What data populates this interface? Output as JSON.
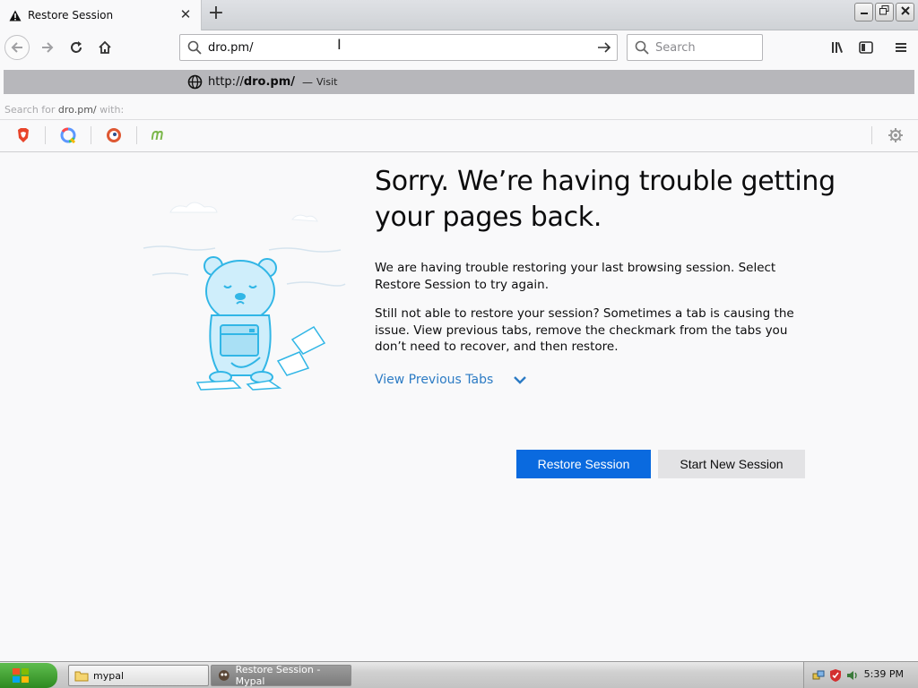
{
  "browser": {
    "tab_title": "Restore Session",
    "new_tab_label": "+",
    "window_controls": [
      "minimize",
      "restore",
      "close"
    ]
  },
  "navbar": {
    "url_value": "dro.pm/",
    "search_placeholder": "Search"
  },
  "dropdown": {
    "suggestion_scheme": "http://",
    "suggestion_host": "dro.pm/",
    "suggestion_dash": "—",
    "suggestion_action": "Visit",
    "search_for_prefix": "Search for",
    "search_for_term": "dro.pm/",
    "search_for_suffix": "with:",
    "engines": [
      "brave-icon",
      "qwant-icon",
      "duckduckgo-icon",
      "mojeek-icon"
    ]
  },
  "page": {
    "title": "Sorry. We’re having trouble getting your pages back.",
    "para1": "We are having trouble restoring your last browsing session. Select Restore Session to try again.",
    "para2": "Still not able to restore your session? Sometimes a tab is causing the issue. View previous tabs, remove the checkmark from the tabs you don’t need to recover, and then restore.",
    "view_previous_label": "View Previous Tabs",
    "restore_button_label": "Restore Session",
    "new_session_button_label": "Start New Session",
    "accent_color": "#0a6adf",
    "link_color": "#2c7bc4"
  },
  "taskbar": {
    "tasks": [
      {
        "label": "mypal",
        "icon": "folder-icon"
      },
      {
        "label": "Restore Session - Mypal",
        "icon": "mypal-icon"
      }
    ],
    "clock": "5:39 PM"
  }
}
